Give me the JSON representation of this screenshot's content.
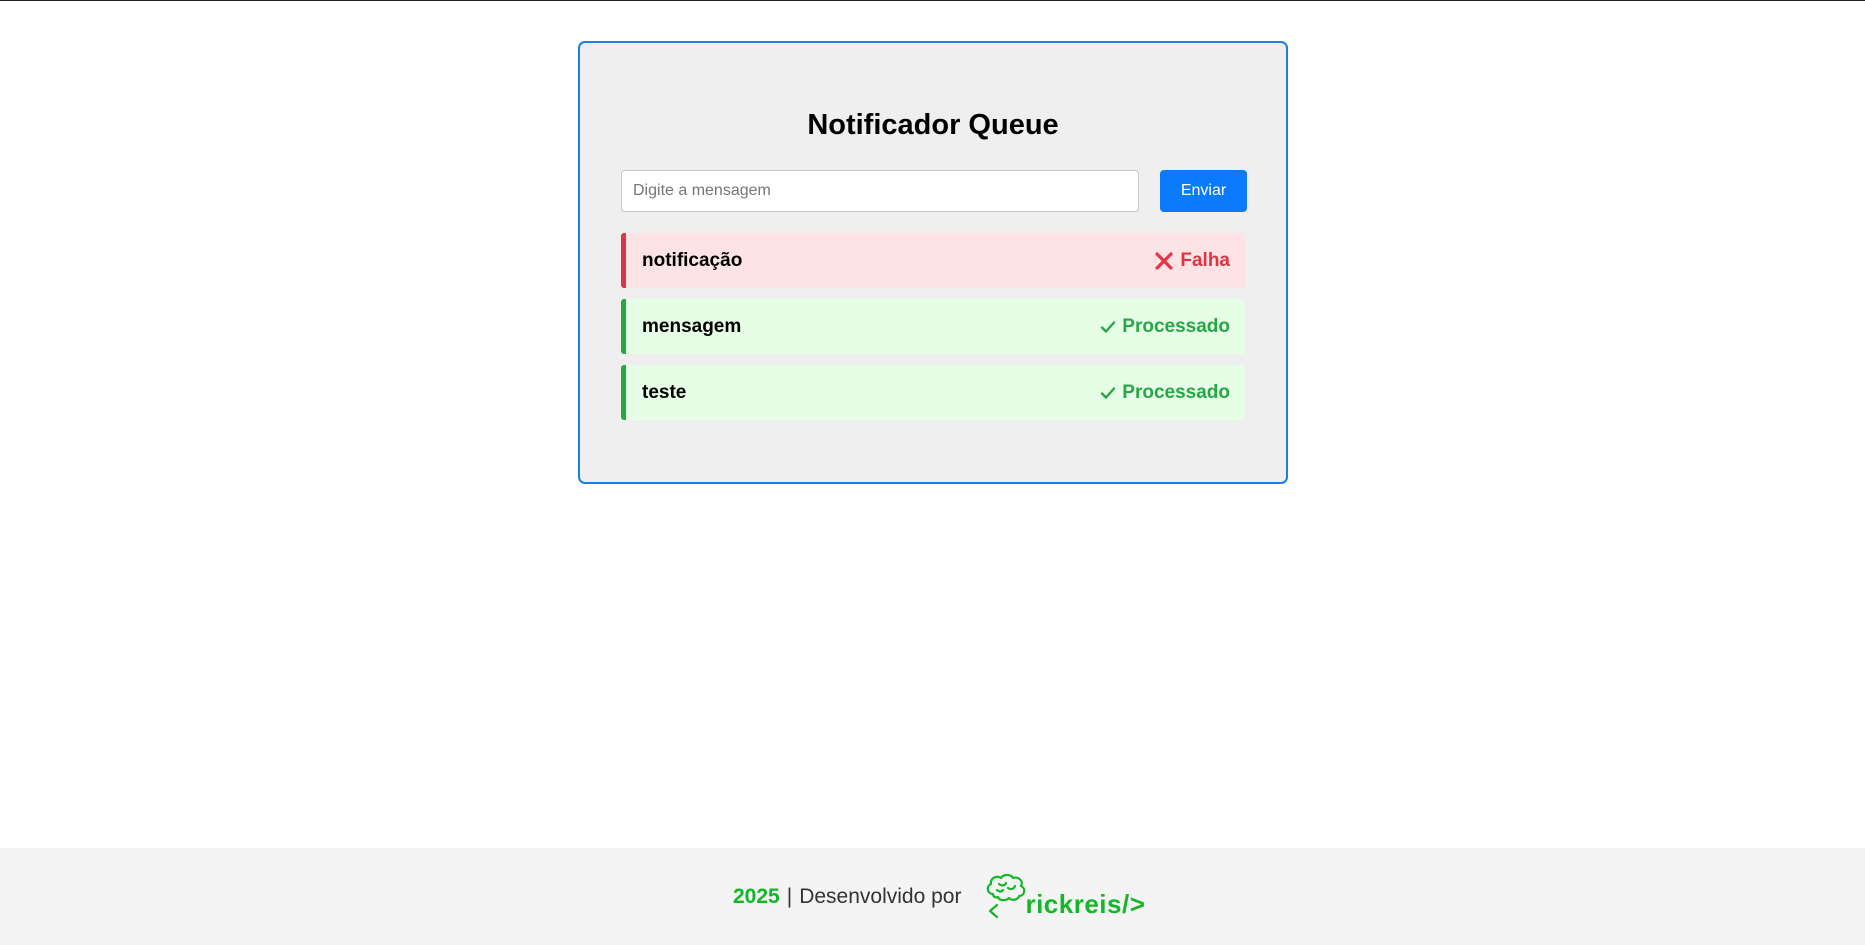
{
  "app": {
    "title": "Notificador Queue"
  },
  "form": {
    "input_placeholder": "Digite a mensagem",
    "input_value": "",
    "send_label": "Enviar"
  },
  "notifications": [
    {
      "text": "notificação",
      "status": "Falha",
      "state": "fail",
      "icon": "x-icon"
    },
    {
      "text": "mensagem",
      "status": "Processado",
      "state": "ok",
      "icon": "check-icon"
    },
    {
      "text": "teste",
      "status": "Processado",
      "state": "ok",
      "icon": "check-icon"
    }
  ],
  "footer": {
    "year": "2025",
    "separator": "|",
    "credit": "Desenvolvido por",
    "logo_text": "rickreis/>"
  },
  "colors": {
    "accent": "#0a7bfd",
    "card_border": "#1a7fe6",
    "fail": "#dc3545",
    "fail_bg": "#fde3e3",
    "ok": "#28a745",
    "ok_bg": "#e6fde6",
    "brand_green": "#16b62a"
  }
}
